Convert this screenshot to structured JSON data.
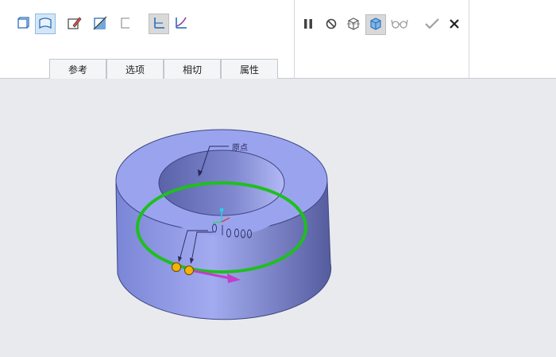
{
  "tabs": [
    {
      "label": "参考"
    },
    {
      "label": "选项"
    },
    {
      "label": "相切"
    },
    {
      "label": "属性"
    }
  ],
  "viewport": {
    "origin_label": "原点"
  },
  "colors": {
    "solid_face": "#9aa4ee",
    "trajectory": "#1fbf1f",
    "direction_arrow": "#c040c8",
    "point_handle": "#f4b400"
  }
}
